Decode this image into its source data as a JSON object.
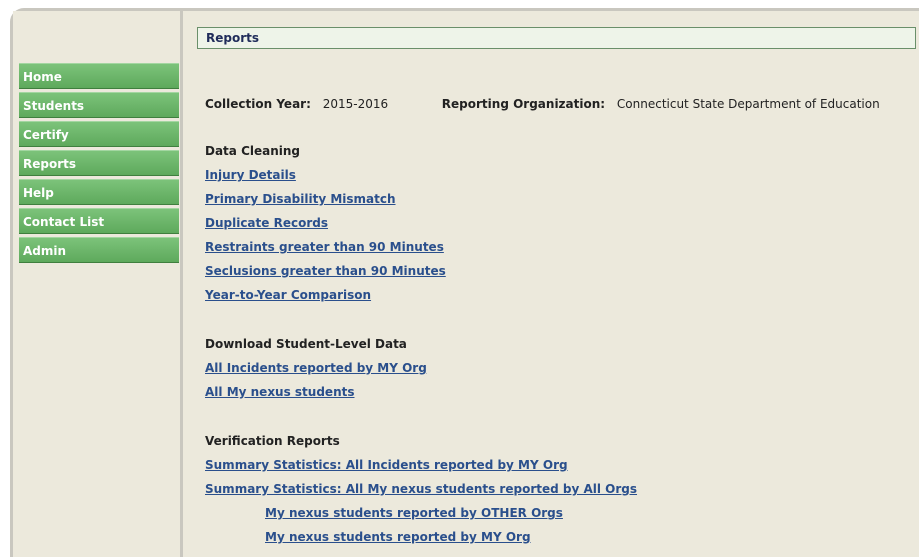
{
  "sidebar": {
    "items": [
      {
        "label": "Home"
      },
      {
        "label": "Students"
      },
      {
        "label": "Certify"
      },
      {
        "label": "Reports"
      },
      {
        "label": "Help"
      },
      {
        "label": "Contact List"
      },
      {
        "label": "Admin"
      }
    ]
  },
  "header": {
    "title": "Reports"
  },
  "info": {
    "collection_year_label": "Collection Year:",
    "collection_year_value": "2015-2016",
    "reporting_org_label": "Reporting Organization:",
    "reporting_org_value": "Connecticut State Department of Education"
  },
  "data_cleaning": {
    "heading": "Data Cleaning",
    "links": [
      "Injury Details",
      "Primary Disability Mismatch",
      "Duplicate Records",
      "Restraints greater than 90 Minutes",
      "Seclusions greater than 90 Minutes",
      "Year-to-Year Comparison"
    ]
  },
  "download": {
    "heading": "Download Student-Level Data",
    "links": [
      "All Incidents reported by MY Org",
      "All My nexus students"
    ]
  },
  "verification": {
    "heading": "Verification Reports",
    "links": [
      "Summary Statistics: All Incidents reported by MY Org",
      "Summary Statistics: All My nexus students reported by All Orgs",
      "My nexus students reported by OTHER Orgs",
      "My nexus students reported by MY Org"
    ]
  }
}
